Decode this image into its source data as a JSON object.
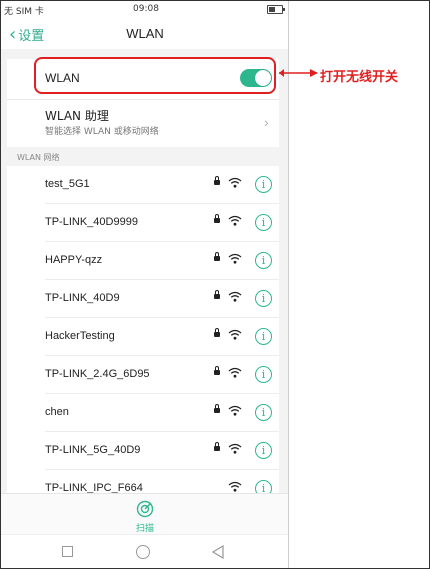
{
  "status_bar": {
    "carrier": "无 SIM 卡",
    "time": "09:08"
  },
  "nav": {
    "back_label": "设置",
    "title": "WLAN"
  },
  "wlan_toggle": {
    "label": "WLAN",
    "state": "on"
  },
  "assistant": {
    "title": "WLAN 助理",
    "subtitle": "智能选择 WLAN 或移动网络"
  },
  "section_label": "WLAN 网络",
  "networks": [
    {
      "name": "test_5G1",
      "locked": true
    },
    {
      "name": "TP-LINK_40D9999",
      "locked": true
    },
    {
      "name": "HAPPY-qzz",
      "locked": true
    },
    {
      "name": "TP-LINK_40D9",
      "locked": true
    },
    {
      "name": "HackerTesting",
      "locked": true
    },
    {
      "name": "TP-LINK_2.4G_6D95",
      "locked": true
    },
    {
      "name": "chen",
      "locked": true
    },
    {
      "name": "TP-LINK_5G_40D9",
      "locked": true
    },
    {
      "name": "TP-LINK_IPC_F664",
      "locked": false
    }
  ],
  "scan_label": "扫描",
  "annotation": "打开无线开关",
  "colors": {
    "accent": "#2eb78f",
    "annotation": "#e02020"
  }
}
